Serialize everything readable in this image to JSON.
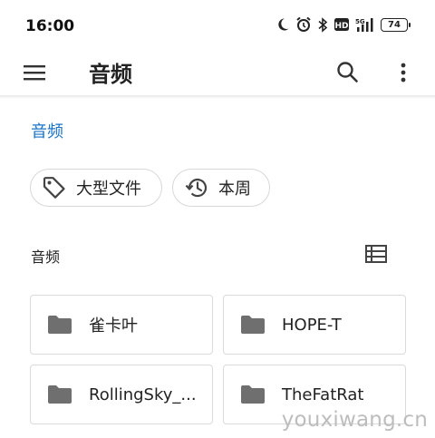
{
  "status_bar": {
    "time": "16:00",
    "icons": [
      "moon-icon",
      "alarm-icon",
      "bluetooth-icon",
      "hd-icon",
      "signal-5g-icon",
      "battery-icon"
    ],
    "hd_label": "HD",
    "network_label": "5G",
    "battery_level": "74"
  },
  "app_bar": {
    "title": "音频",
    "icons": [
      "menu-icon",
      "search-icon",
      "more-vert-icon"
    ]
  },
  "breadcrumb": "音频",
  "filters": [
    {
      "label": "大型文件",
      "icon": "tag-icon"
    },
    {
      "label": "本周",
      "icon": "history-icon"
    }
  ],
  "section": {
    "label": "音频",
    "view_icon": "list-view-icon"
  },
  "folders": [
    {
      "name": "雀卡叶"
    },
    {
      "name": "HOPE-T"
    },
    {
      "name": "RollingSky_..."
    },
    {
      "name": "TheFatRat"
    }
  ],
  "watermark": "youxiwang.cn",
  "colors": {
    "accent": "#1a73c9",
    "folder_icon": "#6f6f6f",
    "border": "#dadada"
  }
}
